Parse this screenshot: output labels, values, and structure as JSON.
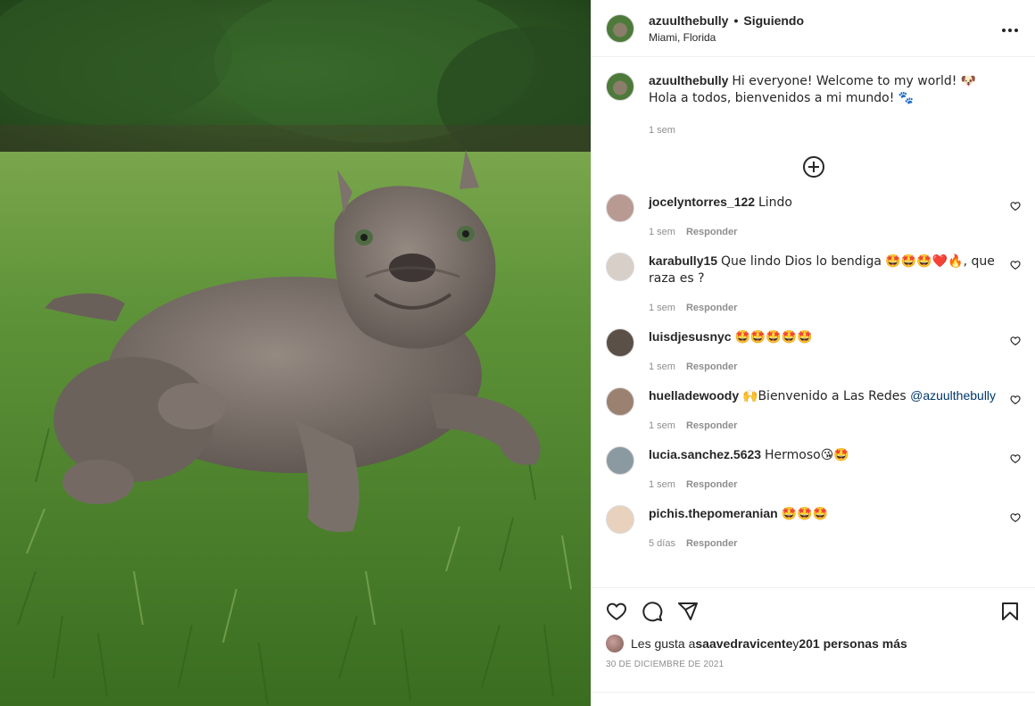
{
  "post": {
    "username": "azuulthebully",
    "separator": "•",
    "follow_status": "Siguiendo",
    "location": "Miami, Florida"
  },
  "caption": {
    "username": "azuulthebully",
    "text": "Hi everyone! Welcome to my world! 🐶 Hola a todos, bienvenidos a mi mundo! 🐾",
    "time": "1 sem"
  },
  "comments": [
    {
      "user": "jocelyntorres_122",
      "text": "Lindo",
      "time": "1 sem",
      "reply": "Responder",
      "avatar_color": "#b99a93"
    },
    {
      "user": "karabully15",
      "text": "Que lindo Dios lo bendiga 🤩🤩🤩❤️🔥, que raza es ?",
      "time": "1 sem",
      "reply": "Responder",
      "avatar_color": "#d7cfc8"
    },
    {
      "user": "luisdjesusnyc",
      "text": "🤩🤩🤩🤩🤩",
      "time": "1 sem",
      "reply": "Responder",
      "avatar_color": "#5b5048"
    },
    {
      "user": "huelladewoody",
      "text": "🙌Bienvenido a Las Redes ",
      "mention": "@azuulthebully",
      "time": "1 sem",
      "reply": "Responder",
      "avatar_color": "#9b8270"
    },
    {
      "user": "lucia.sanchez.5623",
      "text": "Hermoso😘🤩",
      "time": "1 sem",
      "reply": "Responder",
      "avatar_color": "#8a9aa0"
    },
    {
      "user": "pichis.thepomeranian",
      "text": "🤩🤩🤩",
      "time": "5 días",
      "reply": "Responder",
      "avatar_color": "#e8d2bd"
    }
  ],
  "likes": {
    "prefix": "Les gusta a ",
    "user": "saavedravicente",
    "middle": " y ",
    "count": "201 personas más"
  },
  "date": "30 DE DICIEMBRE DE 2021",
  "icons": [
    "heart-icon",
    "comment-icon",
    "share-icon",
    "bookmark-icon",
    "more-icon",
    "add-comment-icon",
    "like-comment-icon"
  ],
  "colors": {
    "text": "#262626",
    "secondary": "#8e8e8e",
    "link": "#00376b",
    "border": "#efefef"
  }
}
